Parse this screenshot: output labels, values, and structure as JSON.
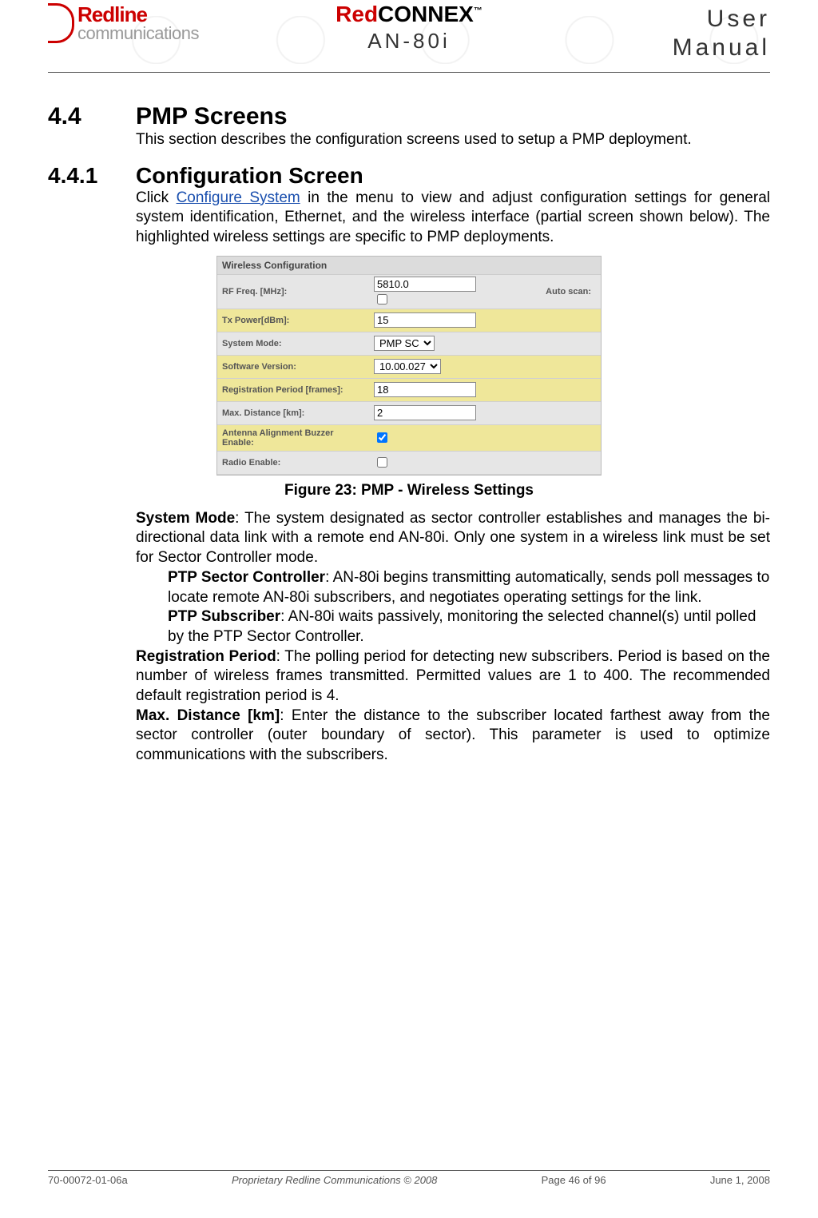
{
  "header": {
    "logo_left_top": "Redline",
    "logo_left_bottom": "communications",
    "brand_red": "Red",
    "brand_black": "CONNEX",
    "brand_tm": "™",
    "model": "AN-80i",
    "right_line1": "User",
    "right_line2": "Manual"
  },
  "section": {
    "num1": "4.4",
    "title1": "PMP Screens",
    "intro1": "This section describes the configuration screens used to setup a PMP deployment.",
    "num2": "4.4.1",
    "title2": "Configuration Screen",
    "intro2a": "Click ",
    "intro2_link": "Configure System",
    "intro2b": " in the menu to view and adjust configuration settings for general system identification, Ethernet, and the wireless interface (partial screen shown below). The highlighted wireless settings are specific to PMP deployments."
  },
  "config": {
    "title": "Wireless Configuration",
    "rows": {
      "rf_freq_label": "RF Freq. [MHz]:",
      "rf_freq_value": "5810.0",
      "auto_scan": "Auto scan:",
      "tx_power_label": "Tx Power[dBm]:",
      "tx_power_value": "15",
      "sys_mode_label": "System Mode:",
      "sys_mode_value": "PMP SC",
      "sw_ver_label": "Software Version:",
      "sw_ver_value": "10.00.027",
      "reg_period_label": "Registration Period [frames]:",
      "reg_period_value": "18",
      "max_dist_label": "Max. Distance [km]:",
      "max_dist_value": "2",
      "antenna_label": "Antenna Alignment Buzzer Enable:",
      "radio_label": "Radio Enable:"
    }
  },
  "caption": "Figure 23: PMP - Wireless Settings",
  "body": {
    "sysmode_b": "System Mode",
    "sysmode_t": ": The system designated as sector controller establishes and manages the bi-directional data link with a remote end AN-80i. Only one system in a wireless link must be set for Sector Controller mode.",
    "ptpsc_b": "PTP Sector Controller",
    "ptpsc_t": ": AN-80i begins transmitting automatically, sends poll messages to locate remote AN-80i subscribers, and negotiates operating settings for the link.",
    "ptpsub_b": "PTP Subscriber",
    "ptpsub_t": ": AN-80i waits passively, monitoring the selected channel(s) until polled by the PTP Sector Controller.",
    "reg_b": "Registration Period",
    "reg_t": ": The polling period for detecting new subscribers. Period is based on the number of wireless frames transmitted. Permitted values are 1 to 400. The recommended default registration period is 4.",
    "max_b": "Max. Distance [km]",
    "max_t": ": Enter the distance to the subscriber located farthest away from the sector controller (outer boundary of sector). This parameter is used to optimize communications with the subscribers."
  },
  "footer": {
    "left": "70-00072-01-06a",
    "center": "Proprietary Redline Communications © 2008",
    "page": "Page 46 of 96",
    "date": "June 1, 2008"
  }
}
